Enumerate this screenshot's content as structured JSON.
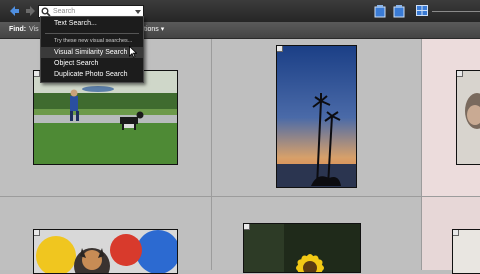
{
  "toolbar": {
    "search": {
      "placeholder": "Search"
    }
  },
  "find_bar": {
    "label": "Find:",
    "partial_text": "Vis",
    "options_label": "tions ▾"
  },
  "search_menu": {
    "items": [
      {
        "label": "Text Search...",
        "style": "normal"
      },
      {
        "label": "Try these new visual searches...",
        "style": "small"
      },
      {
        "label": "Visual Similarity Search",
        "style": "highlighted"
      },
      {
        "label": "Object Search",
        "style": "normal"
      },
      {
        "label": "Duplicate Photo Search",
        "style": "normal"
      }
    ]
  },
  "photos": [
    {
      "subject": "child running with dog on grass"
    },
    {
      "subject": "palm trees at sunset"
    },
    {
      "subject": "portrait (partially visible)"
    },
    {
      "subject": "dog with balloons"
    },
    {
      "subject": "sunflower"
    }
  ],
  "colors": {
    "toolbar_bg": "#2f2f2f",
    "menu_bg": "#1c1c1c",
    "grid_bg": "#bfbfbf",
    "accent_blue": "#3a7bd5"
  }
}
